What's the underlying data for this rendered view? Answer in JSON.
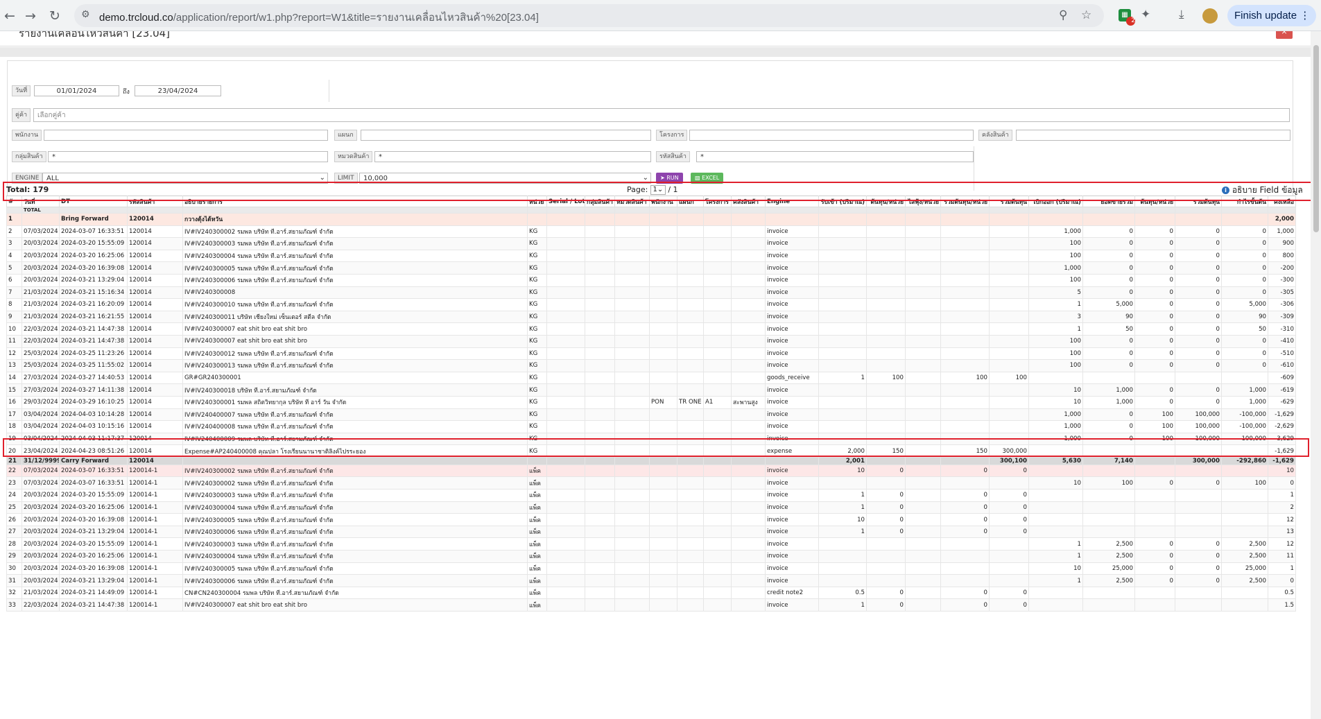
{
  "browser": {
    "url_host": "demo.trcloud.co",
    "url_path": "/application/report/w1.php?report=W1&title=รายงานเคลื่อนไหวสินค้า%20[23.04]",
    "update_label": "Finish update"
  },
  "report": {
    "title": "รายงานเคลื่อนไหวสินค้า [23.04]",
    "close_label": "×"
  },
  "filters": {
    "date_label": "วันที่",
    "date_from": "01/01/2024",
    "to_label": "ถึง",
    "date_to": "23/04/2024",
    "customer_label": "คู่ค้า",
    "customer_placeholder": "เลือกคู่ค้า",
    "staff_label": "พนักงาน",
    "dept_label": "แผนก",
    "project_label": "โครงการ",
    "warehouse_label": "คลังสินค้า",
    "product_group_label": "กลุ่มสินค้า",
    "product_group_value": "*",
    "category_label": "หมวดสินค้า",
    "category_value": "*",
    "product_code_label": "รหัสสินค้า",
    "product_code_value": "*",
    "engine_label": "ENGINE",
    "engine_value": "ALL",
    "limit_label": "LIMIT",
    "limit_value": "10,000",
    "run_label": "RUN",
    "excel_label": "EXCEL"
  },
  "summary": {
    "total_text": "Total: 179",
    "page_label": "Page:",
    "page_value": "1",
    "page_total": "/ 1",
    "field_info": "อธิบาย Field ข้อมูล"
  },
  "columns": [
    "#",
    "วันที่",
    "DT",
    "รหัสสินค้า",
    "อธิบายรายการ",
    "หน่วย",
    "Serial / Lot",
    "กลุ่มสินค้า",
    "หมวดสินค้า",
    "พนักงาน",
    "แผนก",
    "โครงการ",
    "คลังสินค้า",
    "Engine",
    "รับเข้า (ปริมาณ)",
    "ต้นทุน/หน่วย",
    "ไลฟุ้ง/หน่วย",
    "รวมต้นทุน/หน่วย",
    "รวมต้นทุน",
    "เบิกออก (ปริมาณ)",
    "ยอดขายรวม",
    "ต้นทุน/หน่วย",
    "รวมต้นทุน",
    "กำไรขั้นต้น",
    "คงเหลือ"
  ],
  "total_label": "TOTAL",
  "rows": [
    {
      "type": "bf",
      "c": [
        "1",
        "",
        "Bring Forward",
        "120014",
        "กวางตุ้งไต้หวัน",
        "",
        "",
        "",
        "",
        "",
        "",
        "",
        "",
        "",
        "",
        "",
        "",
        "",
        "",
        "",
        "",
        "",
        "",
        "",
        "2,000"
      ]
    },
    {
      "c": [
        "2",
        "07/03/2024",
        "2024-03-07 16:33:51",
        "120014",
        "IV#IV240300002 รมพล บริษัท ที.อาร์.สยามภัณฑ์ จำกัด",
        "KG",
        "",
        "",
        "",
        "",
        "",
        "",
        "",
        "invoice",
        "",
        "",
        "",
        "",
        "",
        "1,000",
        "0",
        "0",
        "0",
        "0",
        "1,000"
      ]
    },
    {
      "c": [
        "3",
        "20/03/2024",
        "2024-03-20 15:55:09",
        "120014",
        "IV#IV240300003 รมพล บริษัท ที.อาร์.สยามภัณฑ์ จำกัด",
        "KG",
        "",
        "",
        "",
        "",
        "",
        "",
        "",
        "invoice",
        "",
        "",
        "",
        "",
        "",
        "100",
        "0",
        "0",
        "0",
        "0",
        "900"
      ]
    },
    {
      "c": [
        "4",
        "20/03/2024",
        "2024-03-20 16:25:06",
        "120014",
        "IV#IV240300004 รมพล บริษัท ที.อาร์.สยามภัณฑ์ จำกัด",
        "KG",
        "",
        "",
        "",
        "",
        "",
        "",
        "",
        "invoice",
        "",
        "",
        "",
        "",
        "",
        "100",
        "0",
        "0",
        "0",
        "0",
        "800"
      ]
    },
    {
      "c": [
        "5",
        "20/03/2024",
        "2024-03-20 16:39:08",
        "120014",
        "IV#IV240300005 รมพล บริษัท ที.อาร์.สยามภัณฑ์ จำกัด",
        "KG",
        "",
        "",
        "",
        "",
        "",
        "",
        "",
        "invoice",
        "",
        "",
        "",
        "",
        "",
        "1,000",
        "0",
        "0",
        "0",
        "0",
        "-200"
      ]
    },
    {
      "c": [
        "6",
        "20/03/2024",
        "2024-03-21 13:29:04",
        "120014",
        "IV#IV240300006 รมพล บริษัท ที.อาร์.สยามภัณฑ์ จำกัด",
        "KG",
        "",
        "",
        "",
        "",
        "",
        "",
        "",
        "invoice",
        "",
        "",
        "",
        "",
        "",
        "100",
        "0",
        "0",
        "0",
        "0",
        "-300"
      ]
    },
    {
      "c": [
        "7",
        "21/03/2024",
        "2024-03-21 15:16:34",
        "120014",
        "IV#IV240300008",
        "KG",
        "",
        "",
        "",
        "",
        "",
        "",
        "",
        "invoice",
        "",
        "",
        "",
        "",
        "",
        "5",
        "0",
        "0",
        "0",
        "0",
        "-305"
      ]
    },
    {
      "c": [
        "8",
        "21/03/2024",
        "2024-03-21 16:20:09",
        "120014",
        "IV#IV240300010 รมพล บริษัท ที.อาร์.สยามภัณฑ์ จำกัด",
        "KG",
        "",
        "",
        "",
        "",
        "",
        "",
        "",
        "invoice",
        "",
        "",
        "",
        "",
        "",
        "1",
        "5,000",
        "0",
        "0",
        "5,000",
        "-306"
      ]
    },
    {
      "c": [
        "9",
        "21/03/2024",
        "2024-03-21 16:21:55",
        "120014",
        "IV#IV240300011 บริษัท เชียงใหม่ เซ็นเตอร์ สตีล จำกัด",
        "KG",
        "",
        "",
        "",
        "",
        "",
        "",
        "",
        "invoice",
        "",
        "",
        "",
        "",
        "",
        "3",
        "90",
        "0",
        "0",
        "90",
        "-309"
      ]
    },
    {
      "c": [
        "10",
        "22/03/2024",
        "2024-03-21 14:47:38",
        "120014",
        "IV#IV240300007 eat shit bro eat shit bro",
        "KG",
        "",
        "",
        "",
        "",
        "",
        "",
        "",
        "invoice",
        "",
        "",
        "",
        "",
        "",
        "1",
        "50",
        "0",
        "0",
        "50",
        "-310"
      ]
    },
    {
      "c": [
        "11",
        "22/03/2024",
        "2024-03-21 14:47:38",
        "120014",
        "IV#IV240300007 eat shit bro eat shit bro",
        "KG",
        "",
        "",
        "",
        "",
        "",
        "",
        "",
        "invoice",
        "",
        "",
        "",
        "",
        "",
        "100",
        "0",
        "0",
        "0",
        "0",
        "-410"
      ]
    },
    {
      "c": [
        "12",
        "25/03/2024",
        "2024-03-25 11:23:26",
        "120014",
        "IV#IV240300012 รมพล บริษัท ที.อาร์.สยามภัณฑ์ จำกัด",
        "KG",
        "",
        "",
        "",
        "",
        "",
        "",
        "",
        "invoice",
        "",
        "",
        "",
        "",
        "",
        "100",
        "0",
        "0",
        "0",
        "0",
        "-510"
      ]
    },
    {
      "c": [
        "13",
        "25/03/2024",
        "2024-03-25 11:55:02",
        "120014",
        "IV#IV240300013 รมพล บริษัท ที.อาร์.สยามภัณฑ์ จำกัด",
        "KG",
        "",
        "",
        "",
        "",
        "",
        "",
        "",
        "invoice",
        "",
        "",
        "",
        "",
        "",
        "100",
        "0",
        "0",
        "0",
        "0",
        "-610"
      ]
    },
    {
      "c": [
        "14",
        "27/03/2024",
        "2024-03-27 14:40:53",
        "120014",
        "GR#GR240300001",
        "KG",
        "",
        "",
        "",
        "",
        "",
        "",
        "",
        "goods_receive",
        "1",
        "100",
        "",
        "100",
        "100",
        "",
        "",
        "",
        "",
        "",
        "-609"
      ]
    },
    {
      "c": [
        "15",
        "27/03/2024",
        "2024-03-27 14:11:38",
        "120014",
        "IV#IV240300018 บริษัท ที.อาร์.สยามภัณฑ์ จำกัด",
        "KG",
        "",
        "",
        "",
        "",
        "",
        "",
        "",
        "invoice",
        "",
        "",
        "",
        "",
        "",
        "10",
        "1,000",
        "0",
        "0",
        "1,000",
        "-619"
      ]
    },
    {
      "c": [
        "16",
        "29/03/2024",
        "2024-03-29 16:10:25",
        "120014",
        "IV#IV240300001 รมพล สถิตวิทยากุล บริษัท ที อาร์ วัน จำกัด",
        "KG",
        "",
        "",
        "",
        "PON",
        "TR ONE",
        "A1",
        "สะพานสูง",
        "invoice",
        "",
        "",
        "",
        "",
        "",
        "10",
        "1,000",
        "0",
        "0",
        "1,000",
        "-629"
      ]
    },
    {
      "c": [
        "17",
        "03/04/2024",
        "2024-04-03 10:14:28",
        "120014",
        "IV#IV240400007 รมพล บริษัท ที.อาร์.สยามภัณฑ์ จำกัด",
        "KG",
        "",
        "",
        "",
        "",
        "",
        "",
        "",
        "invoice",
        "",
        "",
        "",
        "",
        "",
        "1,000",
        "0",
        "100",
        "100,000",
        "-100,000",
        "-1,629"
      ]
    },
    {
      "c": [
        "18",
        "03/04/2024",
        "2024-04-03 10:15:16",
        "120014",
        "IV#IV240400008 รมพล บริษัท ที.อาร์.สยามภัณฑ์ จำกัด",
        "KG",
        "",
        "",
        "",
        "",
        "",
        "",
        "",
        "invoice",
        "",
        "",
        "",
        "",
        "",
        "1,000",
        "0",
        "100",
        "100,000",
        "-100,000",
        "-2,629"
      ]
    },
    {
      "c": [
        "19",
        "03/04/2024",
        "2024-04-03 11:17:37",
        "120014",
        "IV#IV240400009 รมพล บริษัท ที.อาร์.สยามภัณฑ์ จำกัด",
        "KG",
        "",
        "",
        "",
        "",
        "",
        "",
        "",
        "invoice",
        "",
        "",
        "",
        "",
        "",
        "1,000",
        "0",
        "100",
        "100,000",
        "-100,000",
        "-3,629"
      ]
    },
    {
      "c": [
        "20",
        "23/04/2024",
        "2024-04-23 08:51:26",
        "120014",
        "Expense#AP240400008 คุณปลา โรงเรียนนานาชาติลิงค์ไปรระยอง",
        "KG",
        "",
        "",
        "",
        "",
        "",
        "",
        "",
        "expense",
        "2,000",
        "150",
        "",
        "150",
        "300,000",
        "",
        "",
        "",
        "",
        "",
        "-1,629"
      ]
    },
    {
      "type": "cf",
      "c": [
        "21",
        "31/12/9999",
        "Carry Forward",
        "120014",
        "",
        "",
        "",
        "",
        "",
        "",
        "",
        "",
        "",
        "",
        "2,001",
        "",
        "",
        "",
        "300,100",
        "5,630",
        "7,140",
        "",
        "300,000",
        "-292,860",
        "-1,629"
      ]
    },
    {
      "type": "hl",
      "c": [
        "22",
        "07/03/2024",
        "2024-03-07 16:33:51",
        "120014-1",
        "IV#IV240300002 รมพล บริษัท ที.อาร์.สยามภัณฑ์ จำกัด",
        "แพ็ค",
        "",
        "",
        "",
        "",
        "",
        "",
        "",
        "invoice",
        "10",
        "0",
        "",
        "0",
        "0",
        "",
        "",
        "",
        "",
        "",
        "10"
      ]
    },
    {
      "c": [
        "23",
        "07/03/2024",
        "2024-03-07 16:33:51",
        "120014-1",
        "IV#IV240300002 รมพล บริษัท ที.อาร์.สยามภัณฑ์ จำกัด",
        "แพ็ค",
        "",
        "",
        "",
        "",
        "",
        "",
        "",
        "invoice",
        "",
        "",
        "",
        "",
        "",
        "10",
        "100",
        "0",
        "0",
        "100",
        "0"
      ]
    },
    {
      "c": [
        "24",
        "20/03/2024",
        "2024-03-20 15:55:09",
        "120014-1",
        "IV#IV240300003 รมพล บริษัท ที.อาร์.สยามภัณฑ์ จำกัด",
        "แพ็ค",
        "",
        "",
        "",
        "",
        "",
        "",
        "",
        "invoice",
        "1",
        "0",
        "",
        "0",
        "0",
        "",
        "",
        "",
        "",
        "",
        "1"
      ]
    },
    {
      "c": [
        "25",
        "20/03/2024",
        "2024-03-20 16:25:06",
        "120014-1",
        "IV#IV240300004 รมพล บริษัท ที.อาร์.สยามภัณฑ์ จำกัด",
        "แพ็ค",
        "",
        "",
        "",
        "",
        "",
        "",
        "",
        "invoice",
        "1",
        "0",
        "",
        "0",
        "0",
        "",
        "",
        "",
        "",
        "",
        "2"
      ]
    },
    {
      "c": [
        "26",
        "20/03/2024",
        "2024-03-20 16:39:08",
        "120014-1",
        "IV#IV240300005 รมพล บริษัท ที.อาร์.สยามภัณฑ์ จำกัด",
        "แพ็ค",
        "",
        "",
        "",
        "",
        "",
        "",
        "",
        "invoice",
        "10",
        "0",
        "",
        "0",
        "0",
        "",
        "",
        "",
        "",
        "",
        "12"
      ]
    },
    {
      "c": [
        "27",
        "20/03/2024",
        "2024-03-21 13:29:04",
        "120014-1",
        "IV#IV240300006 รมพล บริษัท ที.อาร์.สยามภัณฑ์ จำกัด",
        "แพ็ค",
        "",
        "",
        "",
        "",
        "",
        "",
        "",
        "invoice",
        "1",
        "0",
        "",
        "0",
        "0",
        "",
        "",
        "",
        "",
        "",
        "13"
      ]
    },
    {
      "c": [
        "28",
        "20/03/2024",
        "2024-03-20 15:55:09",
        "120014-1",
        "IV#IV240300003 รมพล บริษัท ที.อาร์.สยามภัณฑ์ จำกัด",
        "แพ็ค",
        "",
        "",
        "",
        "",
        "",
        "",
        "",
        "invoice",
        "",
        "",
        "",
        "",
        "",
        "1",
        "2,500",
        "0",
        "0",
        "2,500",
        "12"
      ]
    },
    {
      "c": [
        "29",
        "20/03/2024",
        "2024-03-20 16:25:06",
        "120014-1",
        "IV#IV240300004 รมพล บริษัท ที.อาร์.สยามภัณฑ์ จำกัด",
        "แพ็ค",
        "",
        "",
        "",
        "",
        "",
        "",
        "",
        "invoice",
        "",
        "",
        "",
        "",
        "",
        "1",
        "2,500",
        "0",
        "0",
        "2,500",
        "11"
      ]
    },
    {
      "c": [
        "30",
        "20/03/2024",
        "2024-03-20 16:39:08",
        "120014-1",
        "IV#IV240300005 รมพล บริษัท ที.อาร์.สยามภัณฑ์ จำกัด",
        "แพ็ค",
        "",
        "",
        "",
        "",
        "",
        "",
        "",
        "invoice",
        "",
        "",
        "",
        "",
        "",
        "10",
        "25,000",
        "0",
        "0",
        "25,000",
        "1"
      ]
    },
    {
      "c": [
        "31",
        "20/03/2024",
        "2024-03-21 13:29:04",
        "120014-1",
        "IV#IV240300006 รมพล บริษัท ที.อาร์.สยามภัณฑ์ จำกัด",
        "แพ็ค",
        "",
        "",
        "",
        "",
        "",
        "",
        "",
        "invoice",
        "",
        "",
        "",
        "",
        "",
        "1",
        "2,500",
        "0",
        "0",
        "2,500",
        "0"
      ]
    },
    {
      "c": [
        "32",
        "21/03/2024",
        "2024-03-21 14:49:09",
        "120014-1",
        "CN#CN240300004 รมพล บริษัท ที.อาร์.สยามภัณฑ์ จำกัด",
        "แพ็ค",
        "",
        "",
        "",
        "",
        "",
        "",
        "",
        "credit note2",
        "0.5",
        "0",
        "",
        "0",
        "0",
        "",
        "",
        "",
        "",
        "",
        "0.5"
      ]
    },
    {
      "c": [
        "33",
        "22/03/2024",
        "2024-03-21 14:47:38",
        "120014-1",
        "IV#IV240300007 eat shit bro eat shit bro",
        "แพ็ค",
        "",
        "",
        "",
        "",
        "",
        "",
        "",
        "invoice",
        "1",
        "0",
        "",
        "0",
        "0",
        "",
        "",
        "",
        "",
        "",
        "1.5"
      ]
    }
  ]
}
